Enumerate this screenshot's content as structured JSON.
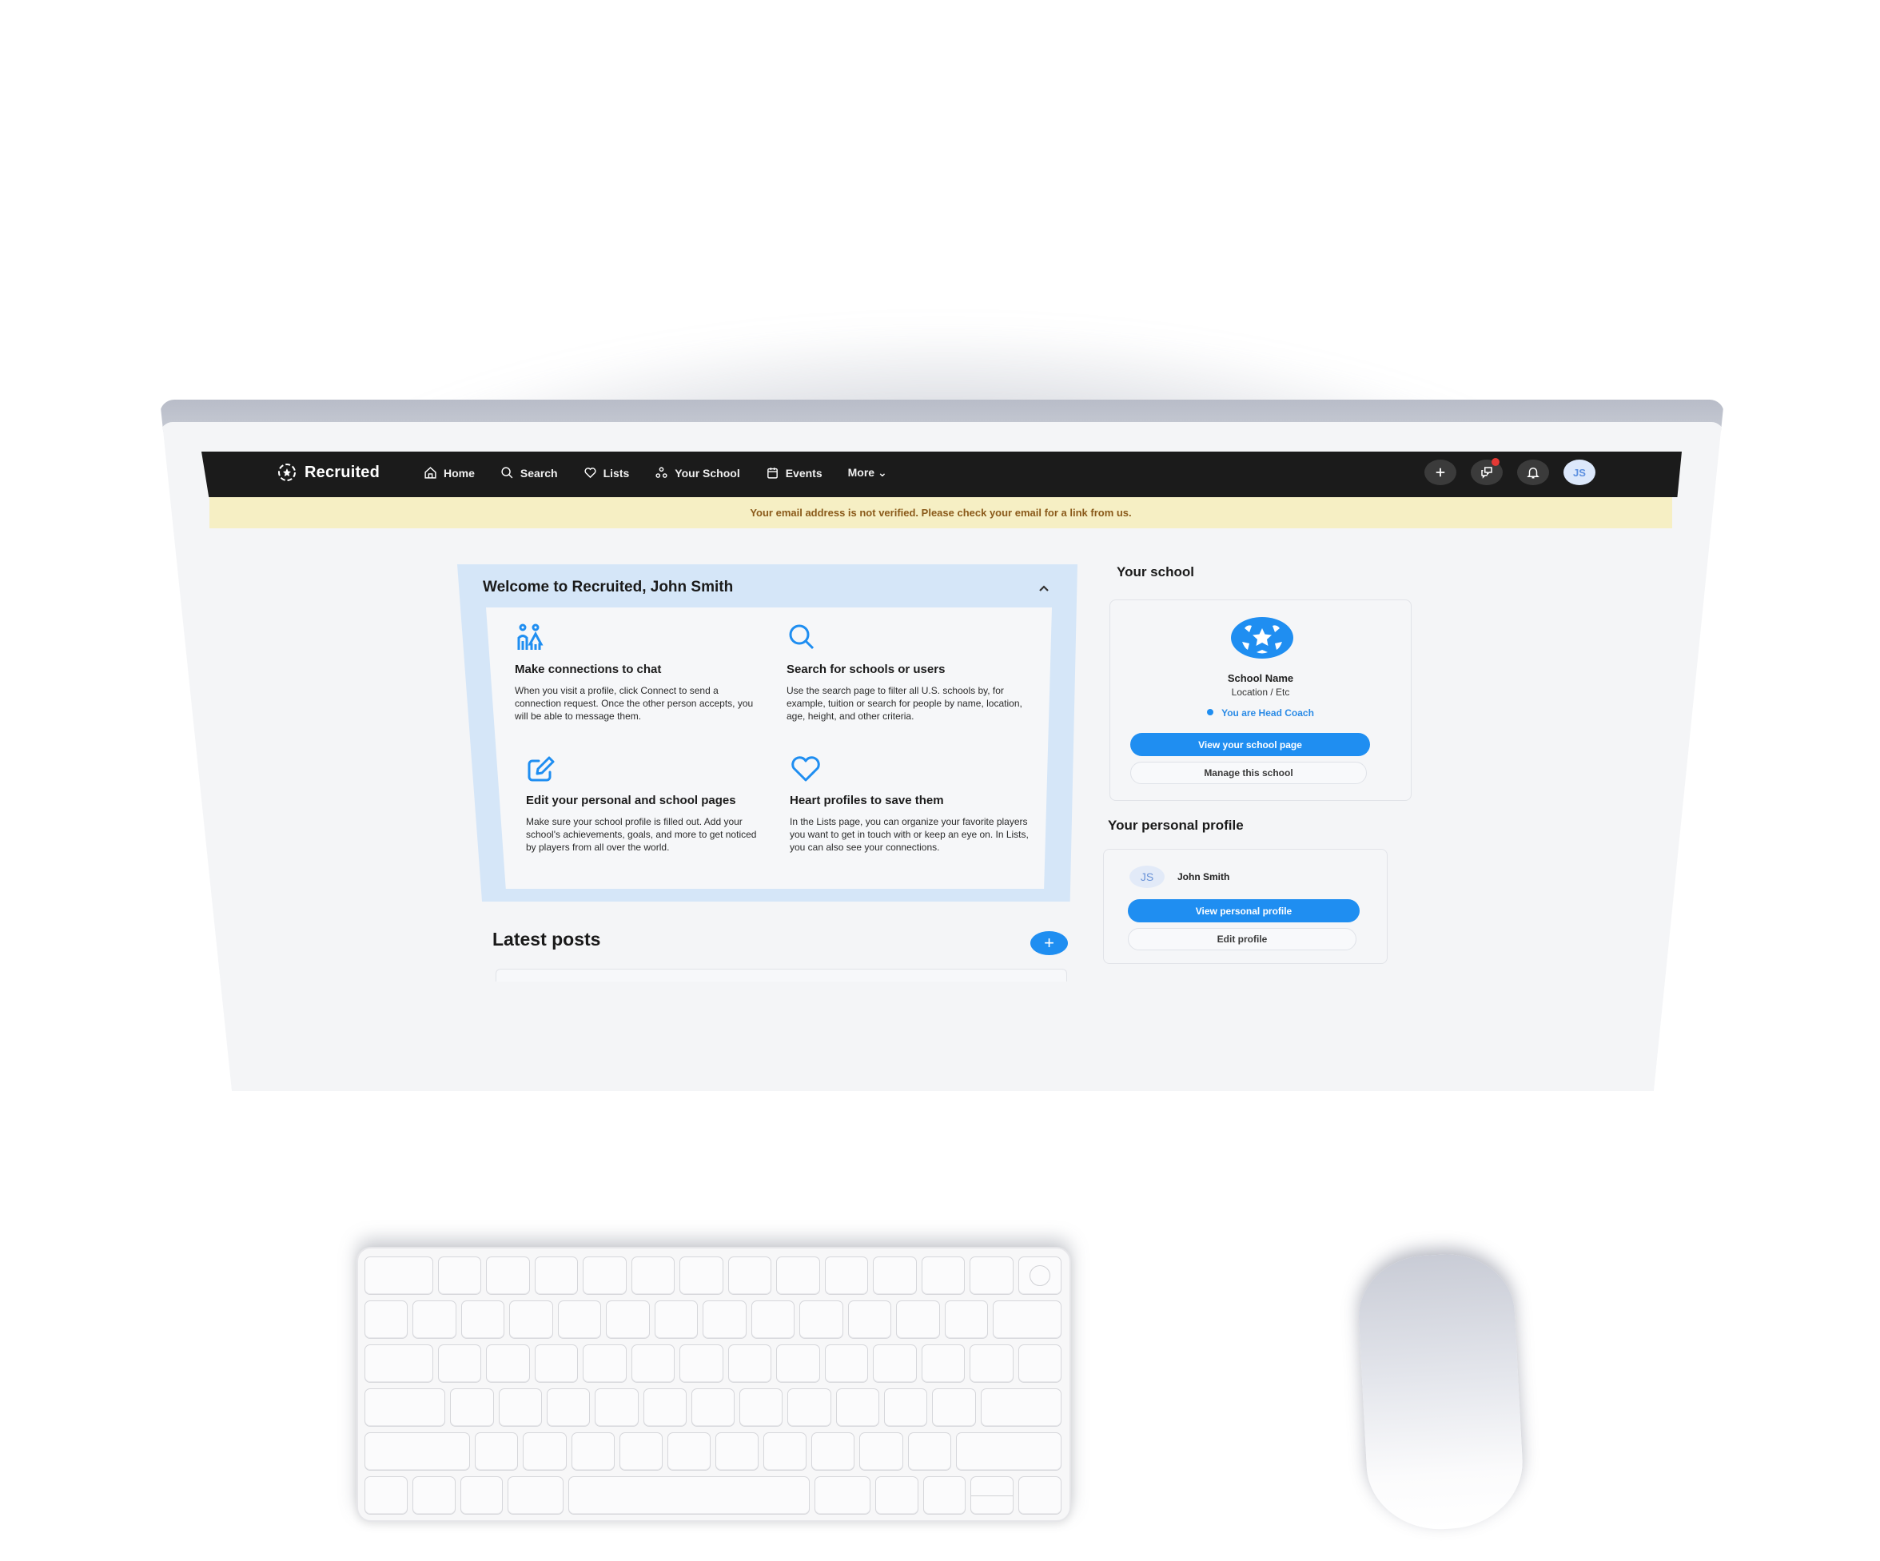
{
  "app": {
    "brand": "Recruited"
  },
  "nav": {
    "items": [
      {
        "label": "Home",
        "icon": "home-icon"
      },
      {
        "label": "Search",
        "icon": "search-icon"
      },
      {
        "label": "Lists",
        "icon": "heart-icon"
      },
      {
        "label": "Your School",
        "icon": "people-icon"
      },
      {
        "label": "Events",
        "icon": "calendar-icon"
      },
      {
        "label": "More ⌄",
        "icon": "chevron-down-icon"
      }
    ],
    "actions": {
      "add_icon": "plus-icon",
      "messages_icon": "chat-icon",
      "messages_has_unread": true,
      "notifications_icon": "bell-icon",
      "avatar_initials": "JS"
    }
  },
  "banner": {
    "text": "Your email address is not verified. Please check your email for a link from us."
  },
  "welcome": {
    "title": "Welcome to Recruited, John Smith",
    "tips": [
      {
        "icon": "people-icon",
        "title": "Make connections to chat",
        "body": "When you visit a profile, click Connect to send a connection request. Once the other person accepts, you will be able to message them."
      },
      {
        "icon": "search-icon",
        "title": "Search for schools or users",
        "body": "Use the search page to filter all U.S. schools by, for example, tuition or search for people by name, location, age, height, and other criteria."
      },
      {
        "icon": "edit-icon",
        "title": "Edit your personal and school pages",
        "body": "Make sure your school profile is filled out. Add your school's achievements, goals, and more to get noticed by players from all over the world."
      },
      {
        "icon": "heart-icon",
        "title": "Heart profiles to save them",
        "body": "In the Lists page, you can organize your favorite players you want to get in touch with or keep an eye on. In Lists, you can also see your connections."
      }
    ]
  },
  "posts": {
    "title": "Latest posts",
    "add_label": "+"
  },
  "school": {
    "section_title": "Your school",
    "name": "School Name",
    "location": "Location / Etc",
    "role": "You are Head Coach",
    "view_button": "View your school page",
    "manage_button": "Manage this school"
  },
  "profile": {
    "section_title": "Your personal profile",
    "initials": "JS",
    "name": "John Smith",
    "view_button": "View personal profile",
    "edit_button": "Edit profile"
  },
  "colors": {
    "accent": "#1f8ef1",
    "navbar": "#1b1b1b",
    "banner_bg": "#f6efc4",
    "banner_text": "#8a5a1a",
    "welcome_bg": "#d5e6f8",
    "notification_dot": "#e53935"
  }
}
